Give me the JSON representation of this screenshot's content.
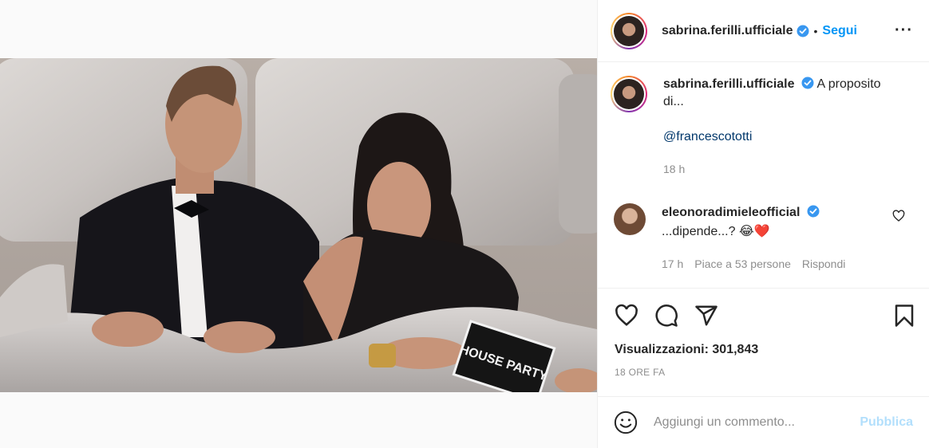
{
  "header": {
    "username": "sabrina.ferilli.ufficiale",
    "separator": "•",
    "follow_label": "Segui",
    "more_label": "···"
  },
  "caption": {
    "username": "sabrina.ferilli.ufficiale",
    "text": "A proposito di...",
    "mention": "@francescototti",
    "time": "18 h"
  },
  "comments": [
    {
      "username": "eleonoradimieleofficial",
      "text": "...dipende...?",
      "emoji": "😂❤️",
      "time": "17 h",
      "likes": "Piace a 53 persone",
      "reply_label": "Rispondi"
    }
  ],
  "stats": {
    "views_label": "Visualizzazioni: 301,843",
    "date": "18 ORE FA"
  },
  "add_comment": {
    "placeholder": "Aggiungi un commento...",
    "publish_label": "Pubblica"
  },
  "video": {
    "card_text": "HOUSE PARTY"
  },
  "colors": {
    "accent": "#0095f6",
    "publish_disabled": "#b2dffc",
    "heart": "#ed4956",
    "verified": "#3897f0"
  },
  "icons": [
    "verified-icon",
    "more-icon",
    "heart-icon",
    "comment-icon",
    "share-icon",
    "bookmark-icon",
    "emoji-icon"
  ]
}
